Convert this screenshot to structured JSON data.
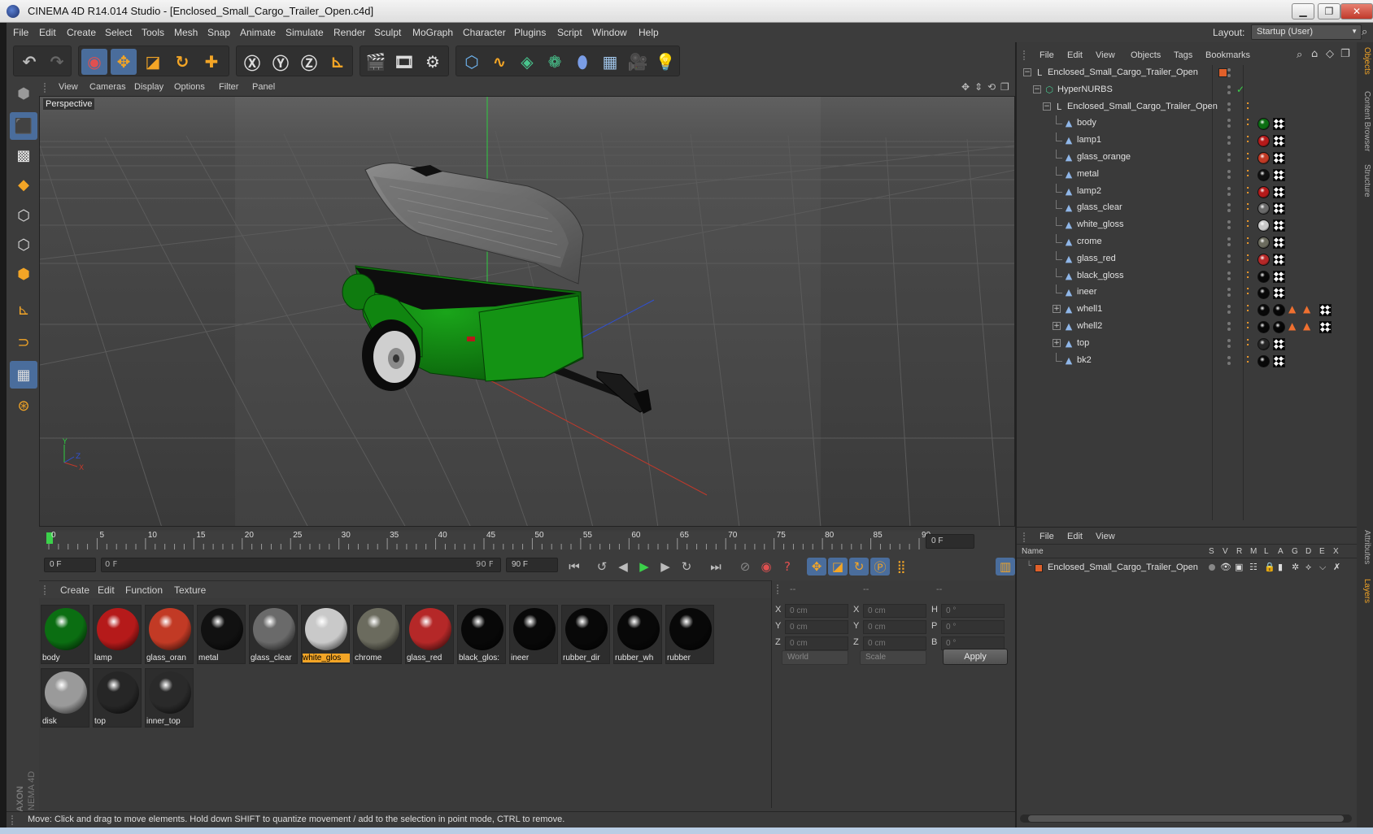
{
  "window": {
    "title": "CINEMA 4D R14.014 Studio - [Enclosed_Small_Cargo_Trailer_Open.c4d]"
  },
  "menubar": {
    "items": [
      "File",
      "Edit",
      "Create",
      "Select",
      "Tools",
      "Mesh",
      "Snap",
      "Animate",
      "Simulate",
      "Render",
      "Sculpt",
      "MoGraph",
      "Character",
      "Plugins",
      "Script",
      "Window",
      "Help"
    ],
    "layout_label": "Layout:",
    "layout_value": "Startup (User)"
  },
  "viewport": {
    "menu": [
      "View",
      "Cameras",
      "Display",
      "Options",
      "Filter",
      "Panel"
    ],
    "label": "Perspective"
  },
  "timeline": {
    "ticks": [
      "0",
      "5",
      "10",
      "15",
      "20",
      "25",
      "30",
      "35",
      "40",
      "45",
      "50",
      "55",
      "60",
      "65",
      "70",
      "75",
      "80",
      "85",
      "90"
    ],
    "current_frame": "0 F",
    "start_field": "0 F",
    "range_start": "0 F",
    "range_end": "90 F",
    "end_field": "90 F"
  },
  "materials": {
    "menu": [
      "Create",
      "Edit",
      "Function",
      "Texture"
    ],
    "items": [
      {
        "label": "body",
        "color": "#0b6e12"
      },
      {
        "label": "lamp",
        "color": "#b51a1a"
      },
      {
        "label": "glass_oran",
        "color": "#c23a25"
      },
      {
        "label": "metal",
        "color": "#111111"
      },
      {
        "label": "glass_clear",
        "color": "#6a6a6a"
      },
      {
        "label": "white_glos",
        "color": "#c9c9c9",
        "selected": true
      },
      {
        "label": "chrome",
        "color": "#6b6b5e"
      },
      {
        "label": "glass_red",
        "color": "#b52828"
      },
      {
        "label": "black_glos:",
        "color": "#080808"
      },
      {
        "label": "ineer",
        "color": "#080808"
      },
      {
        "label": "rubber_dir",
        "color": "#080808"
      },
      {
        "label": "rubber_wh",
        "color": "#080808"
      },
      {
        "label": "rubber",
        "color": "#080808"
      },
      {
        "label": "disk",
        "color": "#9a9a9a"
      },
      {
        "label": "top",
        "color": "#262626"
      },
      {
        "label": "inner_top",
        "color": "#2a2a2a"
      }
    ]
  },
  "coordinates": {
    "headers": [
      "--",
      "--",
      "--"
    ],
    "rows": [
      {
        "a": "X",
        "av": "0 cm",
        "b": "X",
        "bv": "0 cm",
        "c": "H",
        "cv": "0 °"
      },
      {
        "a": "Y",
        "av": "0 cm",
        "b": "Y",
        "bv": "0 cm",
        "c": "P",
        "cv": "0 °"
      },
      {
        "a": "Z",
        "av": "0 cm",
        "b": "Z",
        "bv": "0 cm",
        "c": "B",
        "cv": "0 °"
      }
    ],
    "mode_world": "World",
    "mode_scale": "Scale",
    "apply": "Apply"
  },
  "status": {
    "text": "Move: Click and drag to move elements. Hold down SHIFT to quantize movement / add to the selection in point mode, CTRL to remove."
  },
  "object_manager": {
    "menu": [
      "File",
      "Edit",
      "View",
      "Objects",
      "Tags",
      "Bookmarks"
    ],
    "objects": [
      {
        "name": "Enclosed_Small_Cargo_Trailer_Open",
        "icon": "null-icon",
        "depth": 0
      },
      {
        "name": "HyperNURBS",
        "icon": "hypernurbs-icon",
        "depth": 1
      },
      {
        "name": "Enclosed_Small_Cargo_Trailer_Open",
        "icon": "null-icon",
        "depth": 2
      },
      {
        "name": "body",
        "icon": "polygon-icon",
        "depth": 3,
        "mat": "#0b6e12"
      },
      {
        "name": "lamp1",
        "icon": "polygon-icon",
        "depth": 3,
        "mat": "#b51a1a"
      },
      {
        "name": "glass_orange",
        "icon": "polygon-icon",
        "depth": 3,
        "mat": "#c23a25"
      },
      {
        "name": "metal",
        "icon": "polygon-icon",
        "depth": 3,
        "mat": "#111111"
      },
      {
        "name": "lamp2",
        "icon": "polygon-icon",
        "depth": 3,
        "mat": "#b51a1a"
      },
      {
        "name": "glass_clear",
        "icon": "polygon-icon",
        "depth": 3,
        "mat": "#6a6a6a"
      },
      {
        "name": "white_gloss",
        "icon": "polygon-icon",
        "depth": 3,
        "mat": "#c9c9c9"
      },
      {
        "name": "crome",
        "icon": "polygon-icon",
        "depth": 3,
        "mat": "#6b6b5e"
      },
      {
        "name": "glass_red",
        "icon": "polygon-icon",
        "depth": 3,
        "mat": "#b52828"
      },
      {
        "name": "black_gloss",
        "icon": "polygon-icon",
        "depth": 3,
        "mat": "#080808"
      },
      {
        "name": "ineer",
        "icon": "polygon-icon",
        "depth": 3,
        "mat": "#080808"
      },
      {
        "name": "whell1",
        "icon": "polygon-icon",
        "depth": 3,
        "mat": "#080808",
        "extra": true
      },
      {
        "name": "whell2",
        "icon": "polygon-icon",
        "depth": 3,
        "mat": "#080808",
        "extra": true
      },
      {
        "name": "top",
        "icon": "polygon-icon",
        "depth": 3,
        "mat": "#262626"
      },
      {
        "name": "bk2",
        "icon": "polygon-icon",
        "depth": 3,
        "mat": "#080808"
      }
    ]
  },
  "layer_manager": {
    "menu": [
      "File",
      "Edit",
      "View"
    ],
    "columns": [
      "Name",
      "S",
      "V",
      "R",
      "M",
      "L",
      "A",
      "G",
      "D",
      "E",
      "X"
    ],
    "layers": [
      {
        "name": "Enclosed_Small_Cargo_Trailer_Open",
        "color": "#e0602a"
      }
    ]
  },
  "side_tabs": [
    "Objects",
    "Content Browser",
    "Structure",
    "Attributes",
    "Layers"
  ],
  "brand": {
    "line1": "MAXON",
    "line2": "CINEMA 4D"
  }
}
